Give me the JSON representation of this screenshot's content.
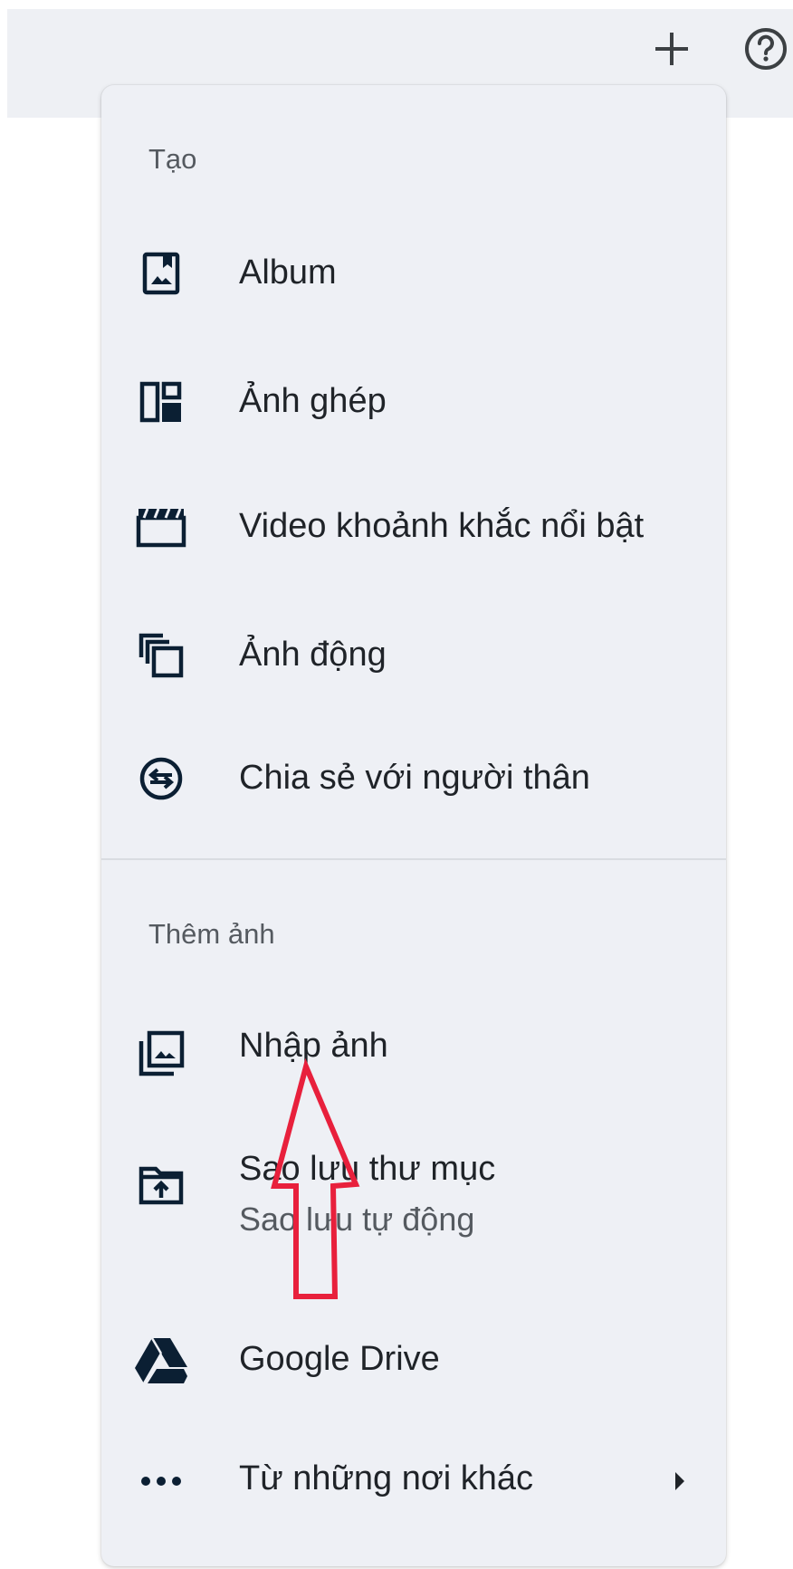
{
  "header": {
    "icons": [
      "add-icon",
      "help-icon"
    ]
  },
  "menu": {
    "create_section": {
      "label": "Tạo",
      "items": [
        {
          "label": "Album",
          "icon": "album-icon"
        },
        {
          "label": "Ảnh ghép",
          "icon": "collage-icon"
        },
        {
          "label": "Video khoảnh khắc nổi bật",
          "icon": "highlight-video-icon"
        },
        {
          "label": "Ảnh động",
          "icon": "animation-icon"
        },
        {
          "label": "Chia sẻ với người thân",
          "icon": "partner-sharing-icon"
        }
      ]
    },
    "add_section": {
      "label": "Thêm ảnh",
      "items": [
        {
          "label": "Nhập ảnh",
          "icon": "import-photos-icon"
        },
        {
          "label": "Sao lưu thư mục",
          "sublabel": "Sao lưu tự động",
          "icon": "backup-folder-icon"
        },
        {
          "label": "Google Drive",
          "icon": "google-drive-icon"
        },
        {
          "label": "Từ những nơi khác",
          "icon": "more-horiz-icon"
        }
      ]
    }
  },
  "colors": {
    "menu_bg": "#eef0f5",
    "icon": "#0b1f33",
    "annotation_arrow": "#e8203c"
  }
}
